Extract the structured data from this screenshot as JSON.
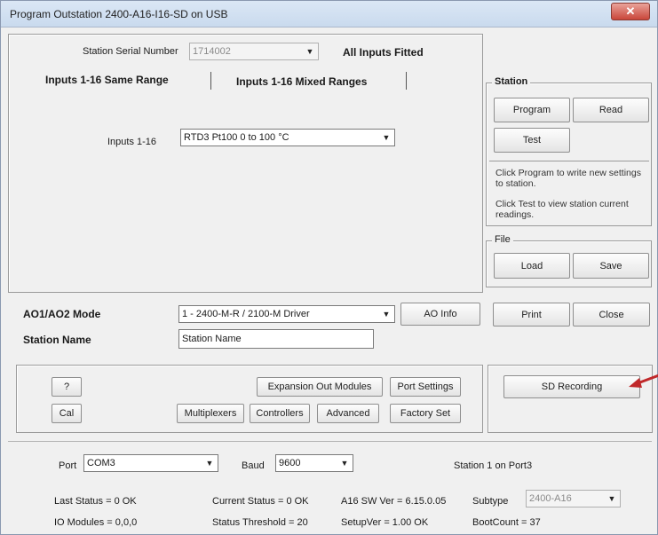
{
  "window": {
    "title": "Program Outstation 2400-A16-I16-SD on USB",
    "close_glyph": "✕"
  },
  "top": {
    "serial_label": "Station Serial Number",
    "serial_value": "1714002",
    "fitted_text": "All Inputs Fitted",
    "tab_same": "Inputs 1-16 Same Range",
    "tab_mixed": "Inputs 1-16 Mixed Ranges",
    "inputs_label": "Inputs 1-16",
    "inputs_value": "RTD3 Pt100 0 to 100 °C"
  },
  "station": {
    "group_label": "Station",
    "program": "Program",
    "read": "Read",
    "test": "Test",
    "hint1": "Click Program to write new settings to station.",
    "hint2": "Click Test to view station current readings."
  },
  "file": {
    "group_label": "File",
    "load": "Load",
    "save": "Save"
  },
  "mode": {
    "ao_label": "AO1/AO2 Mode",
    "ao_value": "1 - 2400-M-R / 2100-M Driver",
    "ao_info": "AO Info",
    "station_name_label": "Station Name",
    "station_name_value": "Station Name",
    "print": "Print",
    "close": "Close"
  },
  "tools": {
    "help": "?",
    "cal": "Cal",
    "expansion": "Expansion Out Modules",
    "port_settings": "Port Settings",
    "multiplexers": "Multiplexers",
    "controllers": "Controllers",
    "advanced": "Advanced",
    "factory_set": "Factory Set",
    "sd_recording": "SD Recording"
  },
  "comms": {
    "port_label": "Port",
    "port_value": "COM3",
    "baud_label": "Baud",
    "baud_value": "9600",
    "station_on_port": "Station 1 on Port3"
  },
  "status": {
    "last_status": "Last Status = 0 OK",
    "current_status": "Current Status = 0 OK",
    "sw_ver": "A16 SW Ver = 6.15.0.05",
    "subtype_label": "Subtype",
    "subtype_value": "2400-A16",
    "io_modules": "IO Modules = 0,0,0",
    "status_threshold": "Status Threshold = 20",
    "setup_ver": "SetupVer = 1.00 OK",
    "boot_count": "BootCount = 37"
  },
  "colors": {
    "annotation_arrow": "#c0282a"
  }
}
